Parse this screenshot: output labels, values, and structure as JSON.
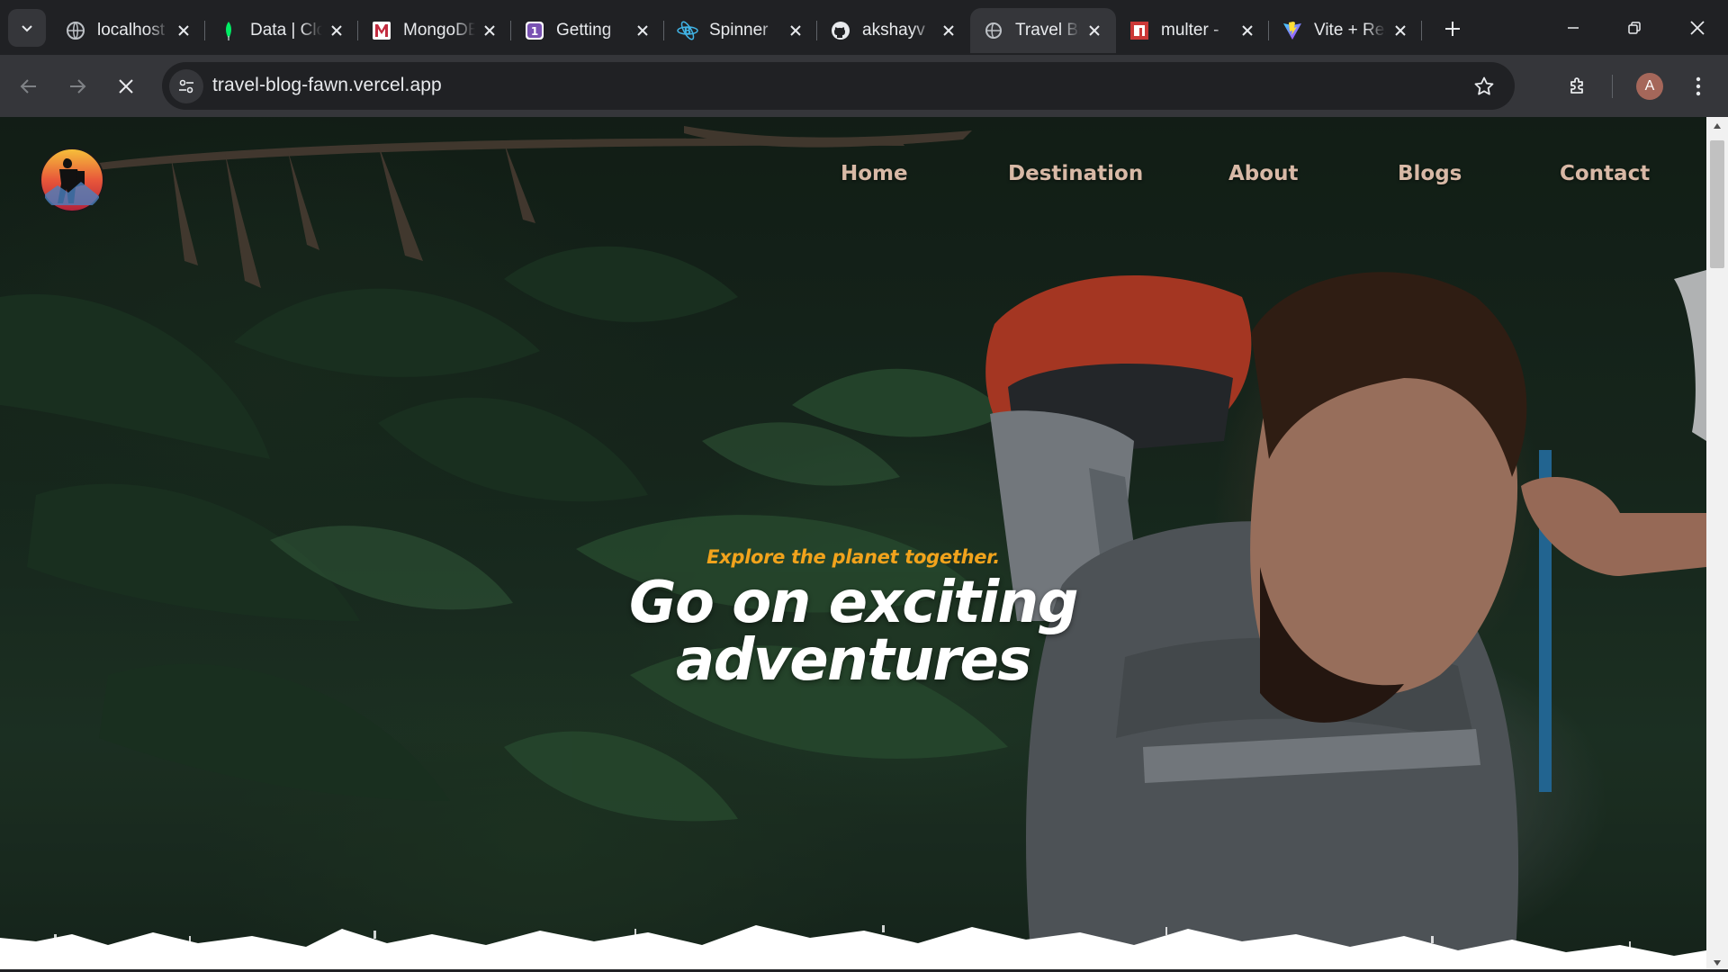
{
  "browser": {
    "tabs": [
      {
        "title": "localhost",
        "icon": "globe-icon"
      },
      {
        "title": "Data | Cloud",
        "icon": "mongodb-leaf-icon"
      },
      {
        "title": "MongoDB",
        "icon": "m-logo-icon"
      },
      {
        "title": "Getting",
        "icon": "bootstrap-icon"
      },
      {
        "title": "Spinner",
        "icon": "react-bootstrap-icon"
      },
      {
        "title": "akshayv",
        "icon": "github-icon"
      },
      {
        "title": "Travel Blog",
        "icon": "loading-globe-icon",
        "active": true
      },
      {
        "title": "multer -",
        "icon": "npm-icon"
      },
      {
        "title": "Vite + React",
        "icon": "vite-icon"
      }
    ],
    "url": "travel-blog-fawn.vercel.app",
    "profile_initial": "A"
  },
  "site": {
    "nav": [
      "Home",
      "Destination",
      "About",
      "Blogs",
      "Contact"
    ],
    "hero": {
      "tagline": "Explore the planet together.",
      "headline_line1": "Go on exciting",
      "headline_line2": "adventures"
    }
  },
  "colors": {
    "accent_orange": "#f1a31c",
    "nav_text": "#d8b9a6",
    "chrome_dark": "#202124",
    "chrome_mid": "#35363a"
  }
}
